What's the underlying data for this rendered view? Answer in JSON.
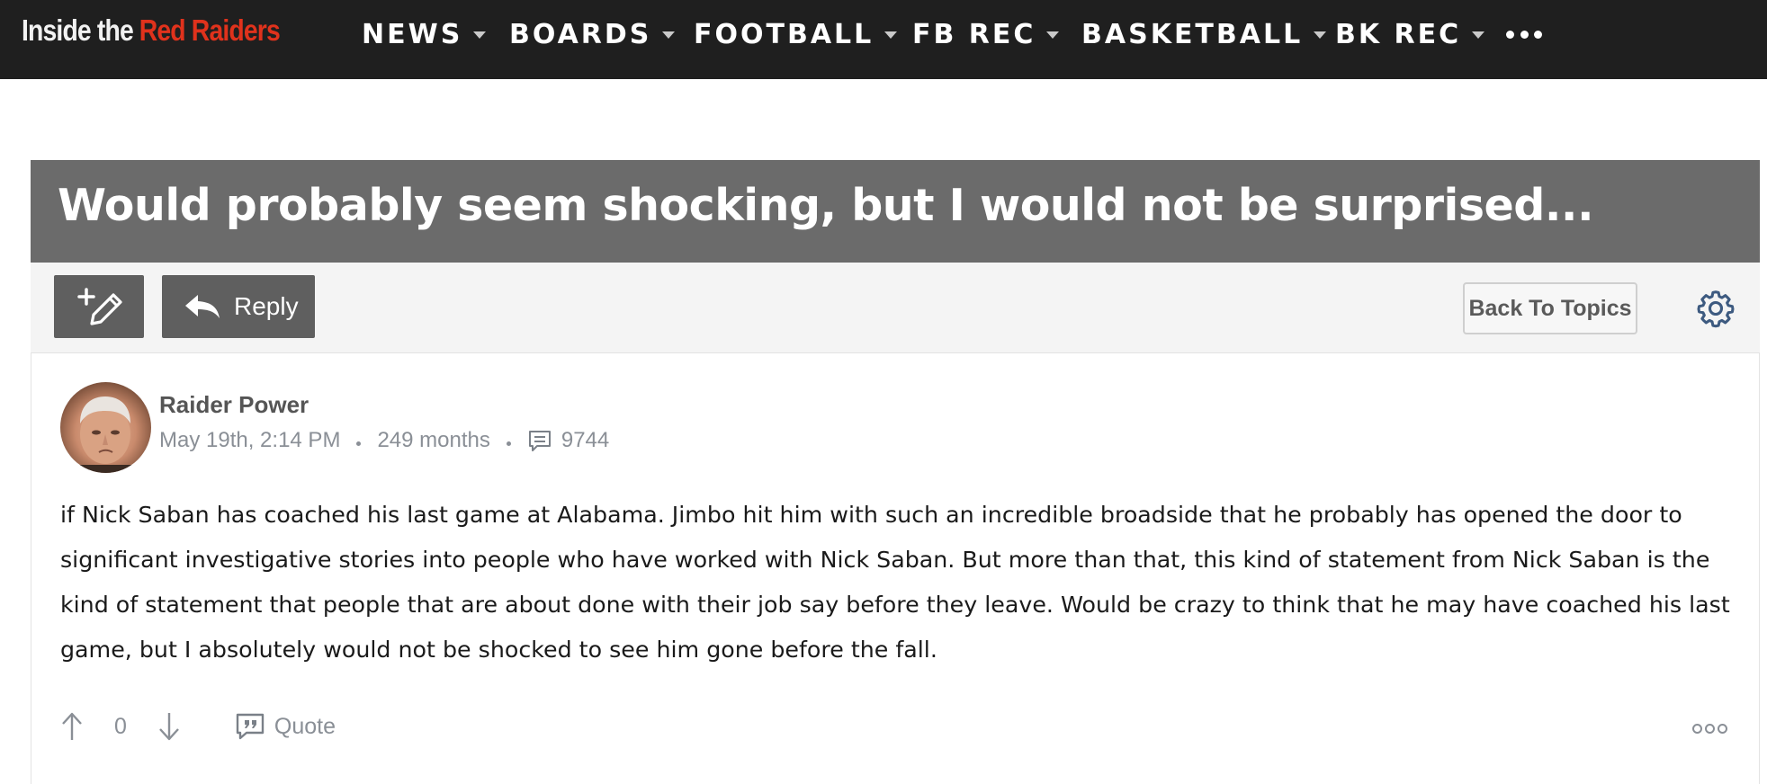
{
  "site": {
    "logo_part1": "Inside the",
    "logo_part2": "Red Raiders"
  },
  "nav": {
    "items": [
      {
        "label": "NEWS"
      },
      {
        "label": "BOARDS"
      },
      {
        "label": "FOOTBALL"
      },
      {
        "label": "FB REC"
      },
      {
        "label": "BASKETBALL"
      },
      {
        "label": "BK REC"
      }
    ],
    "more_icon": "ellipsis-icon"
  },
  "thread": {
    "title": "Would probably seem shocking, but I would not be surprised..."
  },
  "toolbar": {
    "new_topic_icon": "new-post-pencil-icon",
    "reply_label": "Reply",
    "back_label": "Back To Topics",
    "settings_icon": "gear-icon"
  },
  "post": {
    "author": "Raider Power",
    "date": "May 19th, 2:14 PM",
    "tenure": "249 months",
    "post_count": "9744",
    "body": "if Nick Saban has coached his last game at Alabama. Jimbo hit him with such an incredible broadside that he probably has opened the door to significant investigative stories into people who have worked with Nick Saban. But more than that, this kind of statement from Nick Saban is the kind of statement that people that are about done with their job say before they leave. Would be crazy to think that he may have coached his last game, but I absolutely would not be shocked to see him gone before the fall.",
    "votes": "0",
    "quote_label": "Quote"
  },
  "colors": {
    "nav_bg": "#1f1f1f",
    "logo_accent": "#e0321c",
    "title_bg": "#6b6b6b",
    "button_bg": "#5f5f5f",
    "muted_text": "#8a8f96"
  }
}
